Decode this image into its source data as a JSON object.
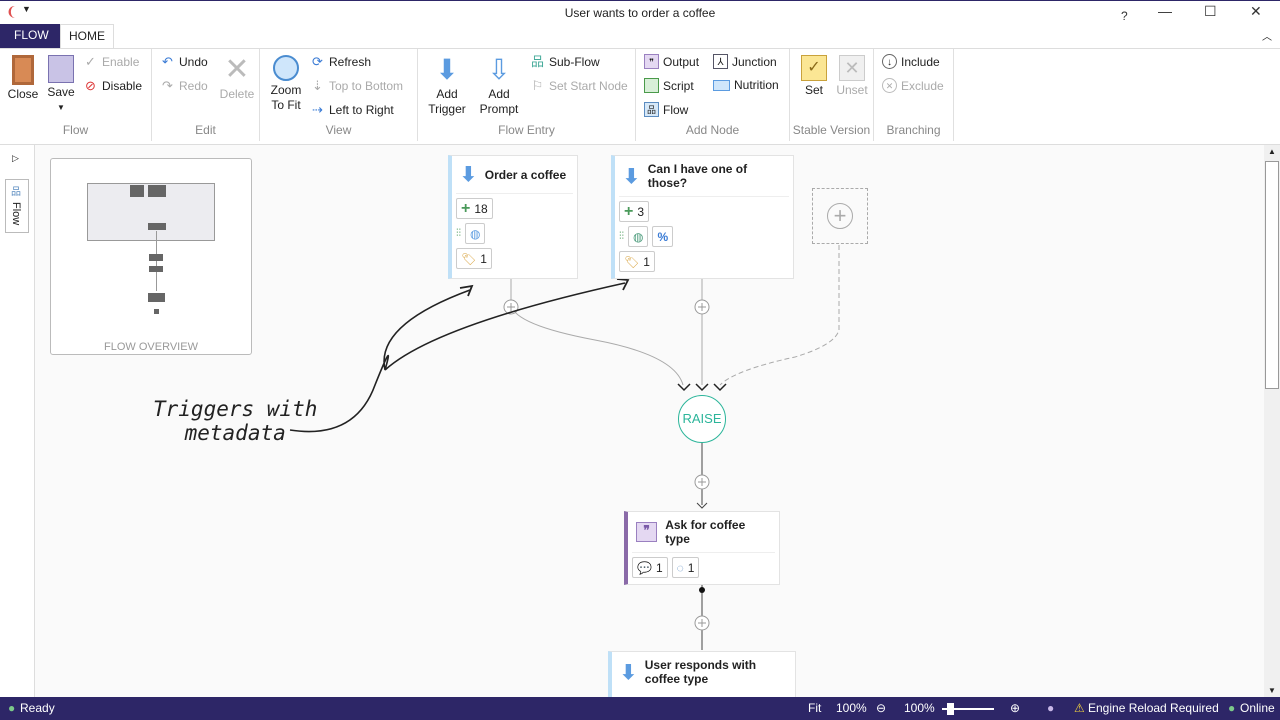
{
  "window": {
    "title": "User wants to order a coffee",
    "help": "?",
    "minimize": "—",
    "maximize": "☐",
    "close": "✕"
  },
  "tabs": [
    {
      "label": "FLOW"
    },
    {
      "label": "HOME"
    }
  ],
  "ribbon": {
    "flow": {
      "label": "Flow",
      "close": "Close",
      "save": "Save",
      "enable": "Enable",
      "disable": "Disable"
    },
    "edit": {
      "label": "Edit",
      "undo": "Undo",
      "redo": "Redo",
      "delete": "Delete"
    },
    "view": {
      "label": "View",
      "zoom_to_fit": "Zoom To Fit",
      "refresh": "Refresh",
      "top_to_bottom": "Top to Bottom",
      "left_to_right": "Left to Right"
    },
    "flow_entry": {
      "label": "Flow Entry",
      "add_trigger": "Add Trigger",
      "add_prompt": "Add Prompt",
      "sub_flow": "Sub-Flow",
      "set_start_node": "Set Start Node"
    },
    "add_node": {
      "label": "Add Node",
      "output": "Output",
      "script": "Script",
      "flow": "Flow",
      "junction": "Junction",
      "nutrition": "Nutrition"
    },
    "stable_version": {
      "label": "Stable Version",
      "set": "Set",
      "unset": "Unset"
    },
    "branching": {
      "label": "Branching",
      "include": "Include",
      "exclude": "Exclude"
    }
  },
  "sidebar": {
    "flow_tab": "Flow"
  },
  "overview": {
    "label": "FLOW OVERVIEW"
  },
  "nodes": {
    "trigger1": {
      "title": "Order a coffee",
      "examples": "18",
      "tags": "1"
    },
    "trigger2": {
      "title": "Can I have one of those?",
      "examples": "3",
      "tags": "1"
    },
    "raise": {
      "label": "RAISE"
    },
    "prompt": {
      "title": "Ask for coffee type",
      "messages": "1",
      "reprompts": "1"
    },
    "trigger3": {
      "title": "User responds with coffee type"
    }
  },
  "annotation": {
    "line1": "Triggers with",
    "line2": "metadata"
  },
  "status": {
    "ready": "Ready",
    "fit": "Fit",
    "zoom1": "100%",
    "zoom2": "100%",
    "engine": "Engine Reload Required",
    "online": "Online"
  },
  "colors": {
    "brand": "#2d2667",
    "trigger_accent": "#bfe0f7",
    "raise": "#2bb59a",
    "prompt_accent": "#8a6aa8"
  }
}
